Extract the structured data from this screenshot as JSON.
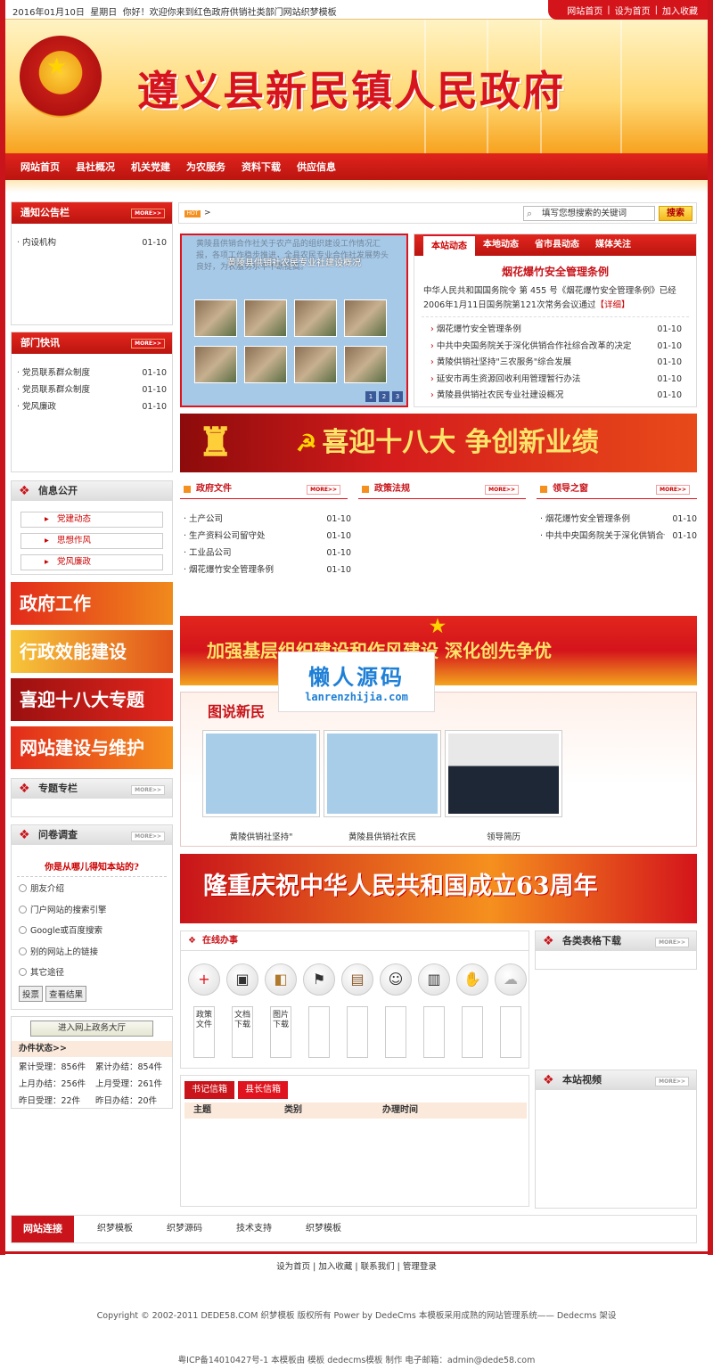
{
  "topbar": {
    "date": "2016年01月10日",
    "weekday": "星期日",
    "welcome": "你好！欢迎你来到红色政府供销社类部门网站织梦模板",
    "links": [
      "网站首页",
      "设为首页",
      "加入收藏"
    ]
  },
  "header": {
    "title": "遵义县新民镇人民政府"
  },
  "nav": [
    "网站首页",
    "县社概况",
    "机关党建",
    "为农服务",
    "资料下载",
    "供应信息"
  ],
  "notice": {
    "title": "通知公告栏",
    "more": "MORE>>",
    "items": [
      {
        "text": "内设机构",
        "date": "01-10"
      }
    ]
  },
  "dept": {
    "title": "部门快讯",
    "more": "MORE>>",
    "items": [
      {
        "text": "党员联系群众制度",
        "date": "01-10"
      },
      {
        "text": "党员联系群众制度",
        "date": "01-10"
      },
      {
        "text": "党风廉政",
        "date": "01-10"
      }
    ]
  },
  "info": {
    "title": "信息公开",
    "items": [
      "党建动态",
      "思想作风",
      "党风廉政"
    ]
  },
  "side_banners": [
    "政府工作",
    "行政效能建设",
    "喜迎十八大专题",
    "网站建设与维护"
  ],
  "topic": {
    "title": "专题专栏",
    "more": "MORE>>"
  },
  "survey": {
    "title": "问卷调查",
    "more": "MORE>>",
    "question": "你是从哪儿得知本站的?",
    "options": [
      "朋友介绍",
      "门户网站的搜索引擎",
      "Google或百度搜索",
      "别的网站上的链接",
      "其它途径"
    ],
    "vote": "投票",
    "results": "查看结果"
  },
  "gov": {
    "button": "进入网上政务大厅",
    "status_title": "办件状态>>",
    "rows": [
      [
        "累计受理：856件",
        "累计办结：854件"
      ],
      [
        "上月办结：256件",
        "上月受理：261件"
      ],
      [
        "昨日受理：22件",
        "昨日办结：20件"
      ]
    ]
  },
  "search": {
    "hot": "HOT",
    "arrow": ">",
    "placeholder": "填写您想搜索的关键词",
    "button": "搜索"
  },
  "slide": {
    "caption": "黄陵县供销社农民专业社建设概况",
    "text": "黄陵县供销合作社关于农产品的组织建设工作情况汇报，各项工作稳步推进，全县农民专业合作社发展势头良好，为农服务水平不断提高。",
    "pages": [
      "1",
      "2",
      "3"
    ]
  },
  "news": {
    "tabs": [
      "本站动态",
      "本地动态",
      "省市县动态",
      "媒体关注"
    ],
    "headline": "烟花爆竹安全管理条例",
    "summary": "中华人民共和国国务院令 第 455 号《烟花爆竹安全管理条例》已经2006年1月11日国务院第121次常务会议通过",
    "detail": "【详细】",
    "items": [
      {
        "text": "烟花爆竹安全管理条例",
        "date": "01-10"
      },
      {
        "text": "中共中央国务院关于深化供销合作社综合改革的决定",
        "date": "01-10"
      },
      {
        "text": "黄陵供销社坚持\"三农服务\"综合发展",
        "date": "01-10"
      },
      {
        "text": "延安市再生资源回收利用管理暂行办法",
        "date": "01-10"
      },
      {
        "text": "黄陵县供销社农民专业社建设概况",
        "date": "01-10"
      }
    ]
  },
  "banner1": "喜迎十八大  争创新业绩",
  "cols": [
    {
      "title": "政府文件",
      "more": "MORE>>",
      "items": [
        {
          "text": "土产公司",
          "date": "01-10"
        },
        {
          "text": "生产资料公司留守处",
          "date": "01-10"
        },
        {
          "text": "工业品公司",
          "date": "01-10"
        },
        {
          "text": "烟花爆竹安全管理条例",
          "date": "01-10"
        }
      ]
    },
    {
      "title": "政策法规",
      "more": "MORE>>",
      "items": []
    },
    {
      "title": "领导之窗",
      "more": "MORE>>",
      "items": [
        {
          "text": "烟花爆竹安全管理条例",
          "date": "01-10"
        },
        {
          "text": "中共中央国务院关于深化供销合作",
          "date": "01-10"
        }
      ]
    }
  ],
  "banner2": "加强基层组织建设和作风建设  深化创先争优",
  "watermark": {
    "name": "懒人源码",
    "url": "lanrenzhijia.com"
  },
  "photo": {
    "title": "图说新民",
    "captions": [
      "黄陵供销社坚持\"",
      "黄陵县供销社农民",
      "领导简历"
    ]
  },
  "banner3": "隆重庆祝中华人民共和国成立63周年",
  "services": {
    "title": "在线办事",
    "icons": [
      "+",
      "▣",
      "◧",
      "⚑",
      "▤",
      "☺",
      "▥",
      "✋",
      "☁"
    ],
    "slots": [
      "政策文件",
      "文档下载",
      "图片下载",
      "",
      "",
      "",
      "",
      "",
      ""
    ]
  },
  "forms": {
    "title": "各类表格下载",
    "more": "MORE>>"
  },
  "video": {
    "title": "本站视频",
    "more": "MORE>>"
  },
  "letters": {
    "tabs": [
      "书记信箱",
      "县长信箱"
    ],
    "cols": [
      "主题",
      "类别",
      "办理时间"
    ]
  },
  "links": {
    "label": "网站连接",
    "items": [
      "织梦模板",
      "织梦源码",
      "技术支持",
      "织梦模板"
    ]
  },
  "footer": {
    "line1": "设为首页   |   加入收藏   |   联系我们   |   管理登录",
    "line2": "Copyright © 2002-2011 DEDE58.COM 织梦模板 版权所有    Power by DedeCms    本模板采用成熟的网站管理系统——  Dedecms 架设",
    "line3": "粤ICP备14010427号-1   本模板由   模板     dedecms模板   制作  电子邮箱：admin@dede58.com"
  }
}
